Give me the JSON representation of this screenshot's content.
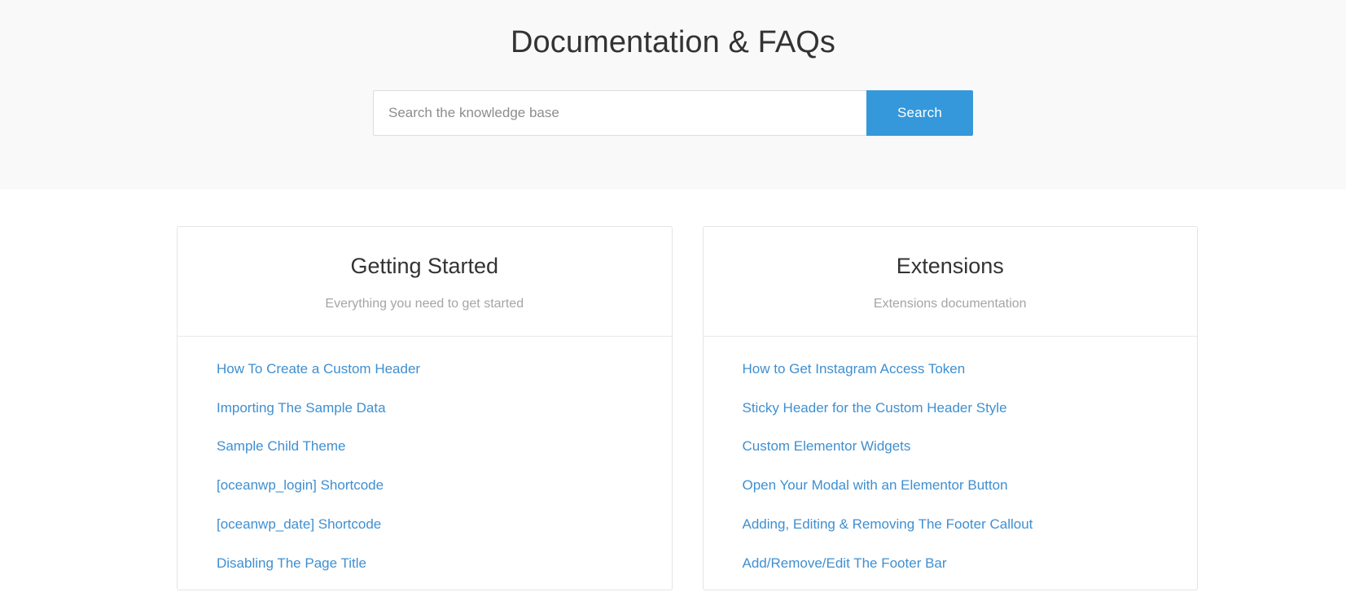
{
  "hero": {
    "title": "Documentation & FAQs",
    "search": {
      "placeholder": "Search the knowledge base",
      "value": "",
      "button_label": "Search"
    }
  },
  "colors": {
    "accent": "#3498db",
    "link": "#3f8fd0",
    "hero_background": "#f9f9f9",
    "card_border": "#e4e4e4",
    "heading_text": "#333333",
    "subtitle_text": "#a5a5a5"
  },
  "cards": [
    {
      "title": "Getting Started",
      "subtitle": "Everything you need to get started",
      "links": [
        "How To Create a Custom Header",
        "Importing The Sample Data",
        "Sample Child Theme",
        "[oceanwp_login] Shortcode",
        "[oceanwp_date] Shortcode",
        "Disabling The Page Title"
      ]
    },
    {
      "title": "Extensions",
      "subtitle": "Extensions documentation",
      "links": [
        "How to Get Instagram Access Token",
        "Sticky Header for the Custom Header Style",
        "Custom Elementor Widgets",
        "Open Your Modal with an Elementor Button",
        "Adding, Editing & Removing The Footer Callout",
        "Add/Remove/Edit The Footer Bar"
      ]
    }
  ]
}
